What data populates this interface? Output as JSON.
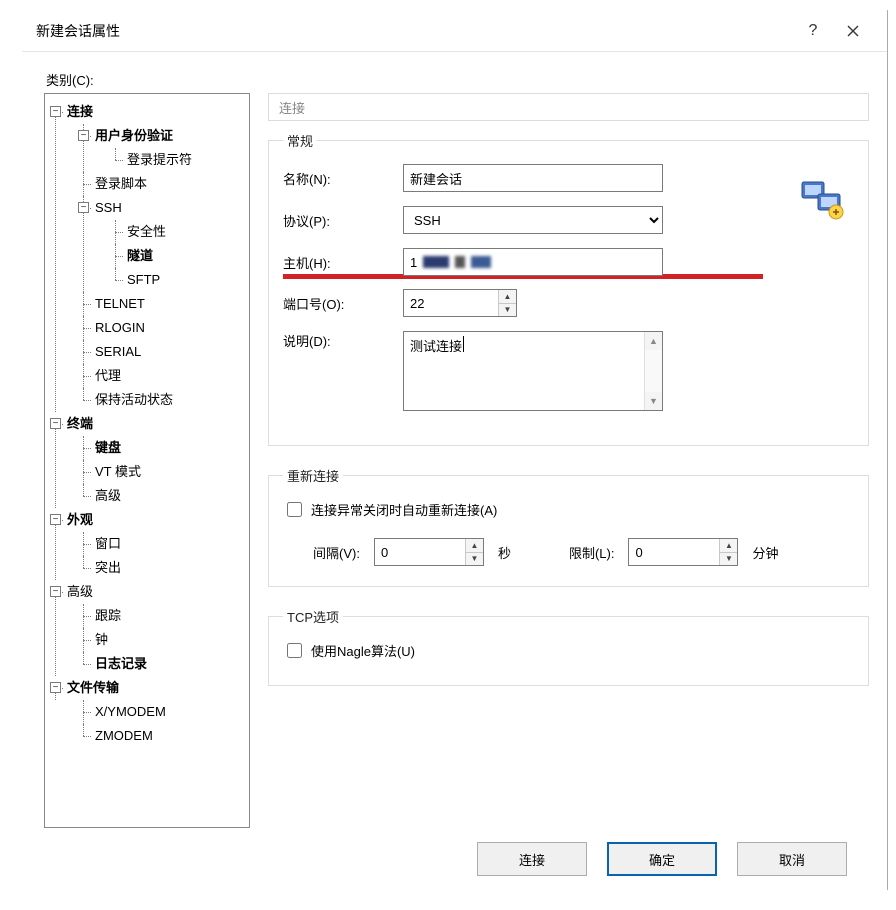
{
  "title": "新建会话属性",
  "category_label": "类别(C):",
  "tree": {
    "connection": "连接",
    "auth": "用户身份验证",
    "login_prompt": "登录提示符",
    "login_script": "登录脚本",
    "ssh": "SSH",
    "security": "安全性",
    "tunnel": "隧道",
    "sftp": "SFTP",
    "telnet": "TELNET",
    "rlogin": "RLOGIN",
    "serial": "SERIAL",
    "proxy": "代理",
    "keepalive": "保持活动状态",
    "terminal": "终端",
    "keyboard": "键盘",
    "vt_mode": "VT 模式",
    "advanced_term": "高级",
    "appearance": "外观",
    "window": "窗口",
    "highlight": "突出",
    "advanced": "高级",
    "trace": "跟踪",
    "bell": "钟",
    "logging": "日志记录",
    "file_transfer": "文件传输",
    "xymodem": "X/YMODEM",
    "zmodem": "ZMODEM"
  },
  "breadcrumb": "连接",
  "general": {
    "legend": "常规",
    "name_label": "名称(N):",
    "name_value": "新建会话",
    "protocol_label": "协议(P):",
    "protocol_value": "SSH",
    "host_label": "主机(H):",
    "host_value": "1",
    "port_label": "端口号(O):",
    "port_value": "22",
    "desc_label": "说明(D):",
    "desc_value": "测试连接"
  },
  "reconnect": {
    "legend": "重新连接",
    "auto_label": "连接异常关闭时自动重新连接(A)",
    "interval_label": "间隔(V):",
    "interval_value": "0",
    "seconds_label": "秒",
    "limit_label": "限制(L):",
    "limit_value": "0",
    "minutes_label": "分钟"
  },
  "tcp": {
    "legend": "TCP选项",
    "nagle_label": "使用Nagle算法(U)"
  },
  "buttons": {
    "connect": "连接",
    "ok": "确定",
    "cancel": "取消"
  }
}
